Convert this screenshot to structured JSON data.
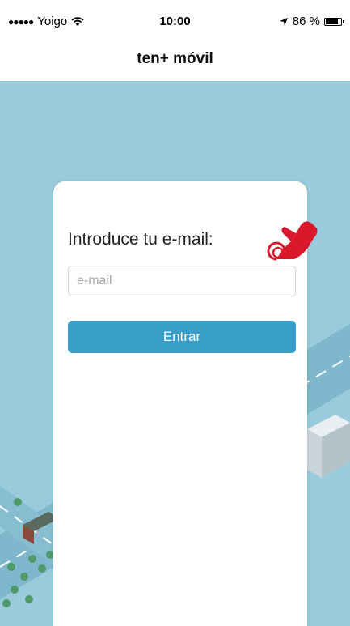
{
  "status_bar": {
    "carrier": "Yoigo",
    "signal_dots": "●●●●●",
    "time": "10:00",
    "battery_percent": "86 %",
    "battery_level": 0.86
  },
  "nav": {
    "title": "ten+ móvil"
  },
  "login": {
    "prompt": "Introduce tu e-mail:",
    "email_placeholder": "e-mail",
    "email_value": "",
    "submit_label": "Entrar"
  },
  "colors": {
    "background": "#9acbdd",
    "button": "#3a9fc8",
    "hand_pointer": "#d9182c"
  },
  "icons": [
    "wifi-icon",
    "location-arrow-icon",
    "battery-icon",
    "tap-hand-icon"
  ]
}
